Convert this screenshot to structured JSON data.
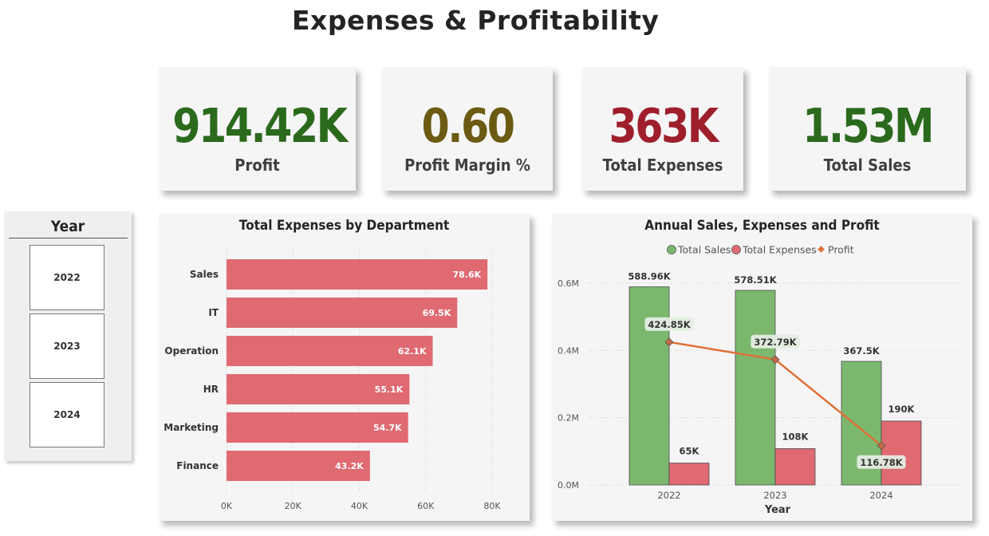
{
  "page": {
    "title": "Expenses & Profitability"
  },
  "kpis": [
    {
      "value": "914.42K",
      "label": "Profit",
      "color": "#2b6a1d"
    },
    {
      "value": "0.60",
      "label": "Profit Margin %",
      "color": "#6b5a12"
    },
    {
      "value": "363K",
      "label": "Total Expenses",
      "color": "#9e1f2b"
    },
    {
      "value": "1.53M",
      "label": "Total Sales",
      "color": "#2b6a1d"
    }
  ],
  "slicer": {
    "title": "Year",
    "options": [
      "2022",
      "2023",
      "2024"
    ]
  },
  "colors": {
    "bar_red": "#e06a72",
    "sales_green": "#7bb86e",
    "profit_orange": "#e07038"
  },
  "chart_data": [
    {
      "type": "bar",
      "title": "Total Expenses by Department",
      "orientation": "horizontal",
      "categories": [
        "Sales",
        "IT",
        "Operation",
        "HR",
        "Marketing",
        "Finance"
      ],
      "values": [
        78.6,
        69.5,
        62.1,
        55.1,
        54.7,
        43.2
      ],
      "value_labels": [
        "78.6K",
        "69.5K",
        "62.1K",
        "55.1K",
        "54.7K",
        "43.2K"
      ],
      "x_ticks": [
        "0K",
        "20K",
        "40K",
        "60K",
        "80K"
      ],
      "xlim": [
        0,
        80
      ],
      "grid": true
    },
    {
      "type": "bar",
      "title": "Annual Sales, Expenses and Profit",
      "xlabel": "Year",
      "categories": [
        "2022",
        "2023",
        "2024"
      ],
      "series": [
        {
          "name": "Total Sales",
          "kind": "bar",
          "values": [
            588.96,
            578.51,
            367.5
          ],
          "labels": [
            "588.96K",
            "578.51K",
            "367.5K"
          ]
        },
        {
          "name": "Total Expenses",
          "kind": "bar",
          "values": [
            65,
            108,
            190
          ],
          "labels": [
            "65K",
            "108K",
            "190K"
          ]
        },
        {
          "name": "Profit",
          "kind": "line",
          "values": [
            424.85,
            372.79,
            116.78
          ],
          "labels": [
            "424.85K",
            "372.79K",
            "116.78K"
          ]
        }
      ],
      "y_ticks": [
        "0.0M",
        "0.2M",
        "0.4M",
        "0.6M"
      ],
      "ylim": [
        0,
        600
      ],
      "legend": "top-center",
      "grid": true
    }
  ]
}
